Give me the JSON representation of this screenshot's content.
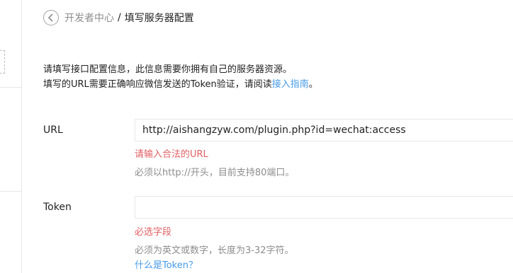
{
  "breadcrumb": {
    "parent": "开发者中心",
    "separator": "/",
    "current": "填写服务器配置"
  },
  "intro": {
    "line1": "请填写接口配置信息，此信息需要你拥有自己的服务器资源。",
    "line2_prefix": "填写的URL需要正确响应微信发送的Token验证，请阅读",
    "line2_link": "接入指南",
    "line2_suffix": "。"
  },
  "form": {
    "url": {
      "label": "URL",
      "value": "http://aishangzyw.com/plugin.php?id=wechat:access",
      "error": "请输入合法的URL",
      "tip": "必须以http://开头，目前支持80端口。"
    },
    "token": {
      "label": "Token",
      "value": "",
      "error": "必选字段",
      "tip": "必须为英文或数字，长度为3-32字符。",
      "help_link": "什么是Token？"
    }
  },
  "colors": {
    "link": "#459ae9",
    "error": "#e15f63",
    "muted": "#8d8d8d",
    "border": "#e7e7eb"
  }
}
